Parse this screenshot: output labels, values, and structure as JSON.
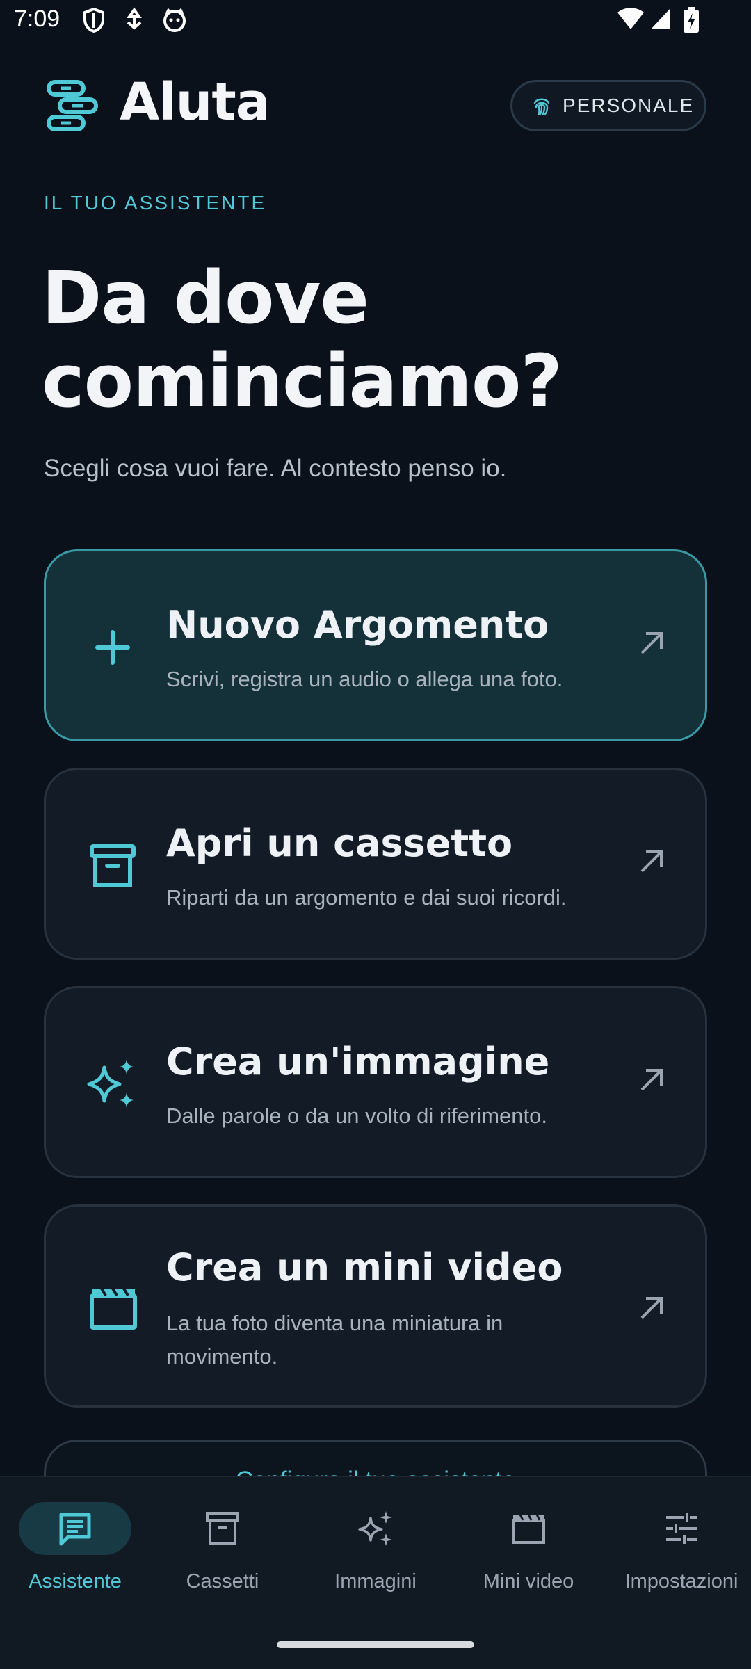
{
  "status_bar": {
    "time": "7:09"
  },
  "header": {
    "app_name": "Aluta",
    "profile_pill": "PERSONALE"
  },
  "hero": {
    "eyebrow": "IL TUO ASSISTENTE",
    "title_line1": "Da dove",
    "title_line2": "cominciamo?",
    "subtitle": "Scegli cosa vuoi fare. Al contesto penso io."
  },
  "cards": [
    {
      "title": "Nuovo Argomento",
      "description": "Scrivi, registra un audio o allega una foto.",
      "icon": "plus-icon"
    },
    {
      "title": "Apri un cassetto",
      "description": "Riparti da un argomento e dai suoi ricordi.",
      "icon": "archive-icon"
    },
    {
      "title": "Crea un'immagine",
      "description": "Dalle parole o da un volto di riferimento.",
      "icon": "sparkles-icon"
    },
    {
      "title": "Crea un mini video",
      "description": "La tua foto diventa una miniatura in movimento.",
      "icon": "clapperboard-icon"
    }
  ],
  "configure_button": {
    "label": "Configura il tuo assistente"
  },
  "bottom_nav": [
    {
      "label": "Assistente",
      "icon": "chat-icon",
      "active": true
    },
    {
      "label": "Cassetti",
      "icon": "archive-icon",
      "active": false
    },
    {
      "label": "Immagini",
      "icon": "sparkles-icon",
      "active": false
    },
    {
      "label": "Mini video",
      "icon": "clapperboard-icon",
      "active": false
    },
    {
      "label": "Impostazioni",
      "icon": "sliders-icon",
      "active": false
    }
  ],
  "colors": {
    "accent": "#4fc9d6",
    "background": "#0a111a",
    "card": "#121b26",
    "card_primary": "#143039"
  }
}
